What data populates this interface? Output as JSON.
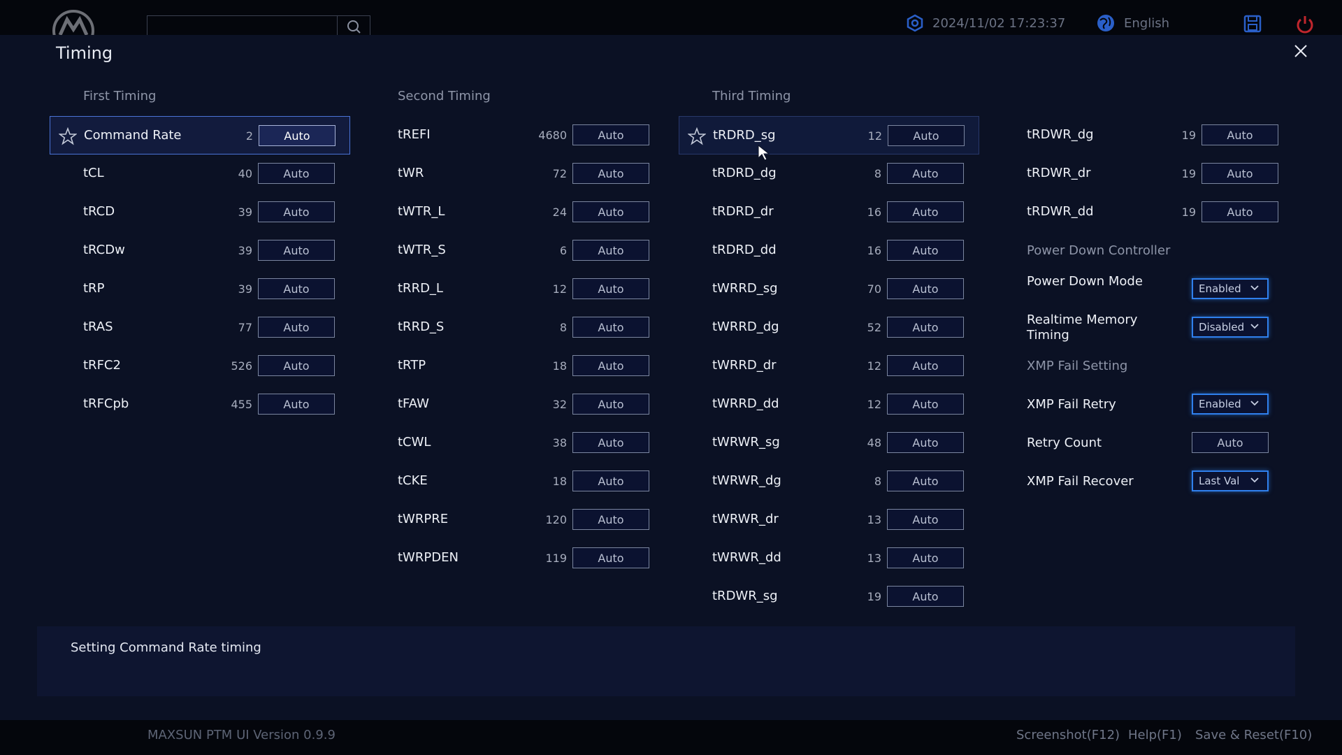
{
  "topbar": {
    "search_placeholder": "",
    "datetime": "2024/11/02 17:23:37",
    "language": "English"
  },
  "panel": {
    "title": "Timing"
  },
  "headings": {
    "first": "First Timing",
    "second": "Second Timing",
    "third": "Third Timing",
    "power_down": "Power Down Controller",
    "xmp_fail": "XMP Fail Setting"
  },
  "first_timing": [
    {
      "label": "Command Rate",
      "value": "2",
      "button": "Auto"
    },
    {
      "label": "tCL",
      "value": "40",
      "button": "Auto"
    },
    {
      "label": "tRCD",
      "value": "39",
      "button": "Auto"
    },
    {
      "label": "tRCDw",
      "value": "39",
      "button": "Auto"
    },
    {
      "label": "tRP",
      "value": "39",
      "button": "Auto"
    },
    {
      "label": "tRAS",
      "value": "77",
      "button": "Auto"
    },
    {
      "label": "tRFC2",
      "value": "526",
      "button": "Auto"
    },
    {
      "label": "tRFCpb",
      "value": "455",
      "button": "Auto"
    }
  ],
  "second_timing": [
    {
      "label": "tREFI",
      "value": "4680",
      "button": "Auto"
    },
    {
      "label": "tWR",
      "value": "72",
      "button": "Auto"
    },
    {
      "label": "tWTR_L",
      "value": "24",
      "button": "Auto"
    },
    {
      "label": "tWTR_S",
      "value": "6",
      "button": "Auto"
    },
    {
      "label": "tRRD_L",
      "value": "12",
      "button": "Auto"
    },
    {
      "label": "tRRD_S",
      "value": "8",
      "button": "Auto"
    },
    {
      "label": "tRTP",
      "value": "18",
      "button": "Auto"
    },
    {
      "label": "tFAW",
      "value": "32",
      "button": "Auto"
    },
    {
      "label": "tCWL",
      "value": "38",
      "button": "Auto"
    },
    {
      "label": "tCKE",
      "value": "18",
      "button": "Auto"
    },
    {
      "label": "tWRPRE",
      "value": "120",
      "button": "Auto"
    },
    {
      "label": "tWRPDEN",
      "value": "119",
      "button": "Auto"
    }
  ],
  "third_timing": [
    {
      "label": "tRDRD_sg",
      "value": "12",
      "button": "Auto"
    },
    {
      "label": "tRDRD_dg",
      "value": "8",
      "button": "Auto"
    },
    {
      "label": "tRDRD_dr",
      "value": "16",
      "button": "Auto"
    },
    {
      "label": "tRDRD_dd",
      "value": "16",
      "button": "Auto"
    },
    {
      "label": "tWRRD_sg",
      "value": "70",
      "button": "Auto"
    },
    {
      "label": "tWRRD_dg",
      "value": "52",
      "button": "Auto"
    },
    {
      "label": "tWRRD_dr",
      "value": "12",
      "button": "Auto"
    },
    {
      "label": "tWRRD_dd",
      "value": "12",
      "button": "Auto"
    },
    {
      "label": "tWRWR_sg",
      "value": "48",
      "button": "Auto"
    },
    {
      "label": "tWRWR_dg",
      "value": "8",
      "button": "Auto"
    },
    {
      "label": "tWRWR_dr",
      "value": "13",
      "button": "Auto"
    },
    {
      "label": "tWRWR_dd",
      "value": "13",
      "button": "Auto"
    },
    {
      "label": "tRDWR_sg",
      "value": "19",
      "button": "Auto"
    }
  ],
  "fourth_timing": [
    {
      "label": "tRDWR_dg",
      "value": "19",
      "button": "Auto"
    },
    {
      "label": "tRDWR_dr",
      "value": "19",
      "button": "Auto"
    },
    {
      "label": "tRDWR_dd",
      "value": "19",
      "button": "Auto"
    }
  ],
  "power_down": [
    {
      "label": "Power Down Mode",
      "selected": "Enabled"
    },
    {
      "label": "Realtime Memory Timing",
      "selected": "Disabled"
    }
  ],
  "xmp_fail": {
    "retry_label": "XMP Fail Retry",
    "retry_selected": "Enabled",
    "count_label": "Retry Count",
    "count_button": "Auto",
    "recover_label": "XMP Fail Recover",
    "recover_selected": "Last Val"
  },
  "help_text": "Setting Command Rate timing",
  "footer": {
    "version": "MAXSUN PTM UI Version 0.9.9",
    "screenshot": "Screenshot(F12)",
    "help": "Help(F1)",
    "save_reset": "Save & Reset(F10)"
  },
  "colors": {
    "accent": "#2f80ed",
    "power_icon": "#c0262d",
    "save_icon": "#2a5fc8"
  }
}
